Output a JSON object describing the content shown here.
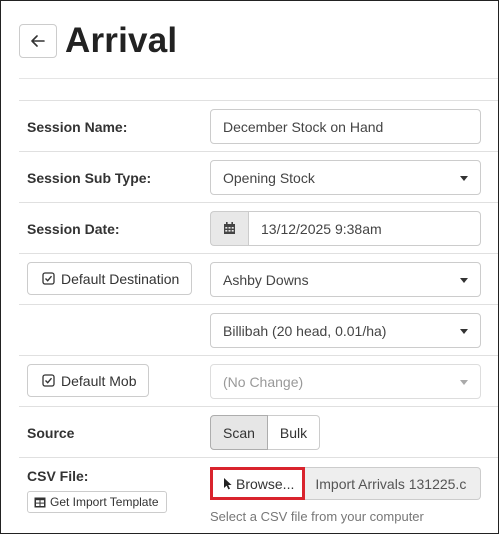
{
  "page": {
    "title": "Arrival"
  },
  "header": {
    "back_icon": "arrow-left-icon"
  },
  "form": {
    "session_name": {
      "label": "Session Name:",
      "value": "December Stock on Hand"
    },
    "session_sub_type": {
      "label": "Session Sub Type:",
      "value": "Opening Stock"
    },
    "session_date": {
      "label": "Session Date:",
      "value": "13/12/2025 9:38am",
      "icon": "calendar-icon"
    },
    "default_destination": {
      "button_label": "Default Destination",
      "property_value": "Ashby Downs",
      "paddock_value": "Billibah (20 head, 0.01/ha)"
    },
    "default_mob": {
      "button_label": "Default Mob",
      "value": "(No Change)"
    },
    "source": {
      "label": "Source",
      "options": [
        "Scan",
        "Bulk"
      ],
      "selected": "Scan"
    },
    "csv_file": {
      "label": "CSV File:",
      "template_button": "Get Import Template",
      "browse_label": "Browse...",
      "file_name": "Import Arrivals 131225.c",
      "help_text": "Select a CSV file from your computer"
    }
  },
  "colors": {
    "highlight": "#d9232d",
    "toggle_active_bg": "#e6e6e6"
  }
}
